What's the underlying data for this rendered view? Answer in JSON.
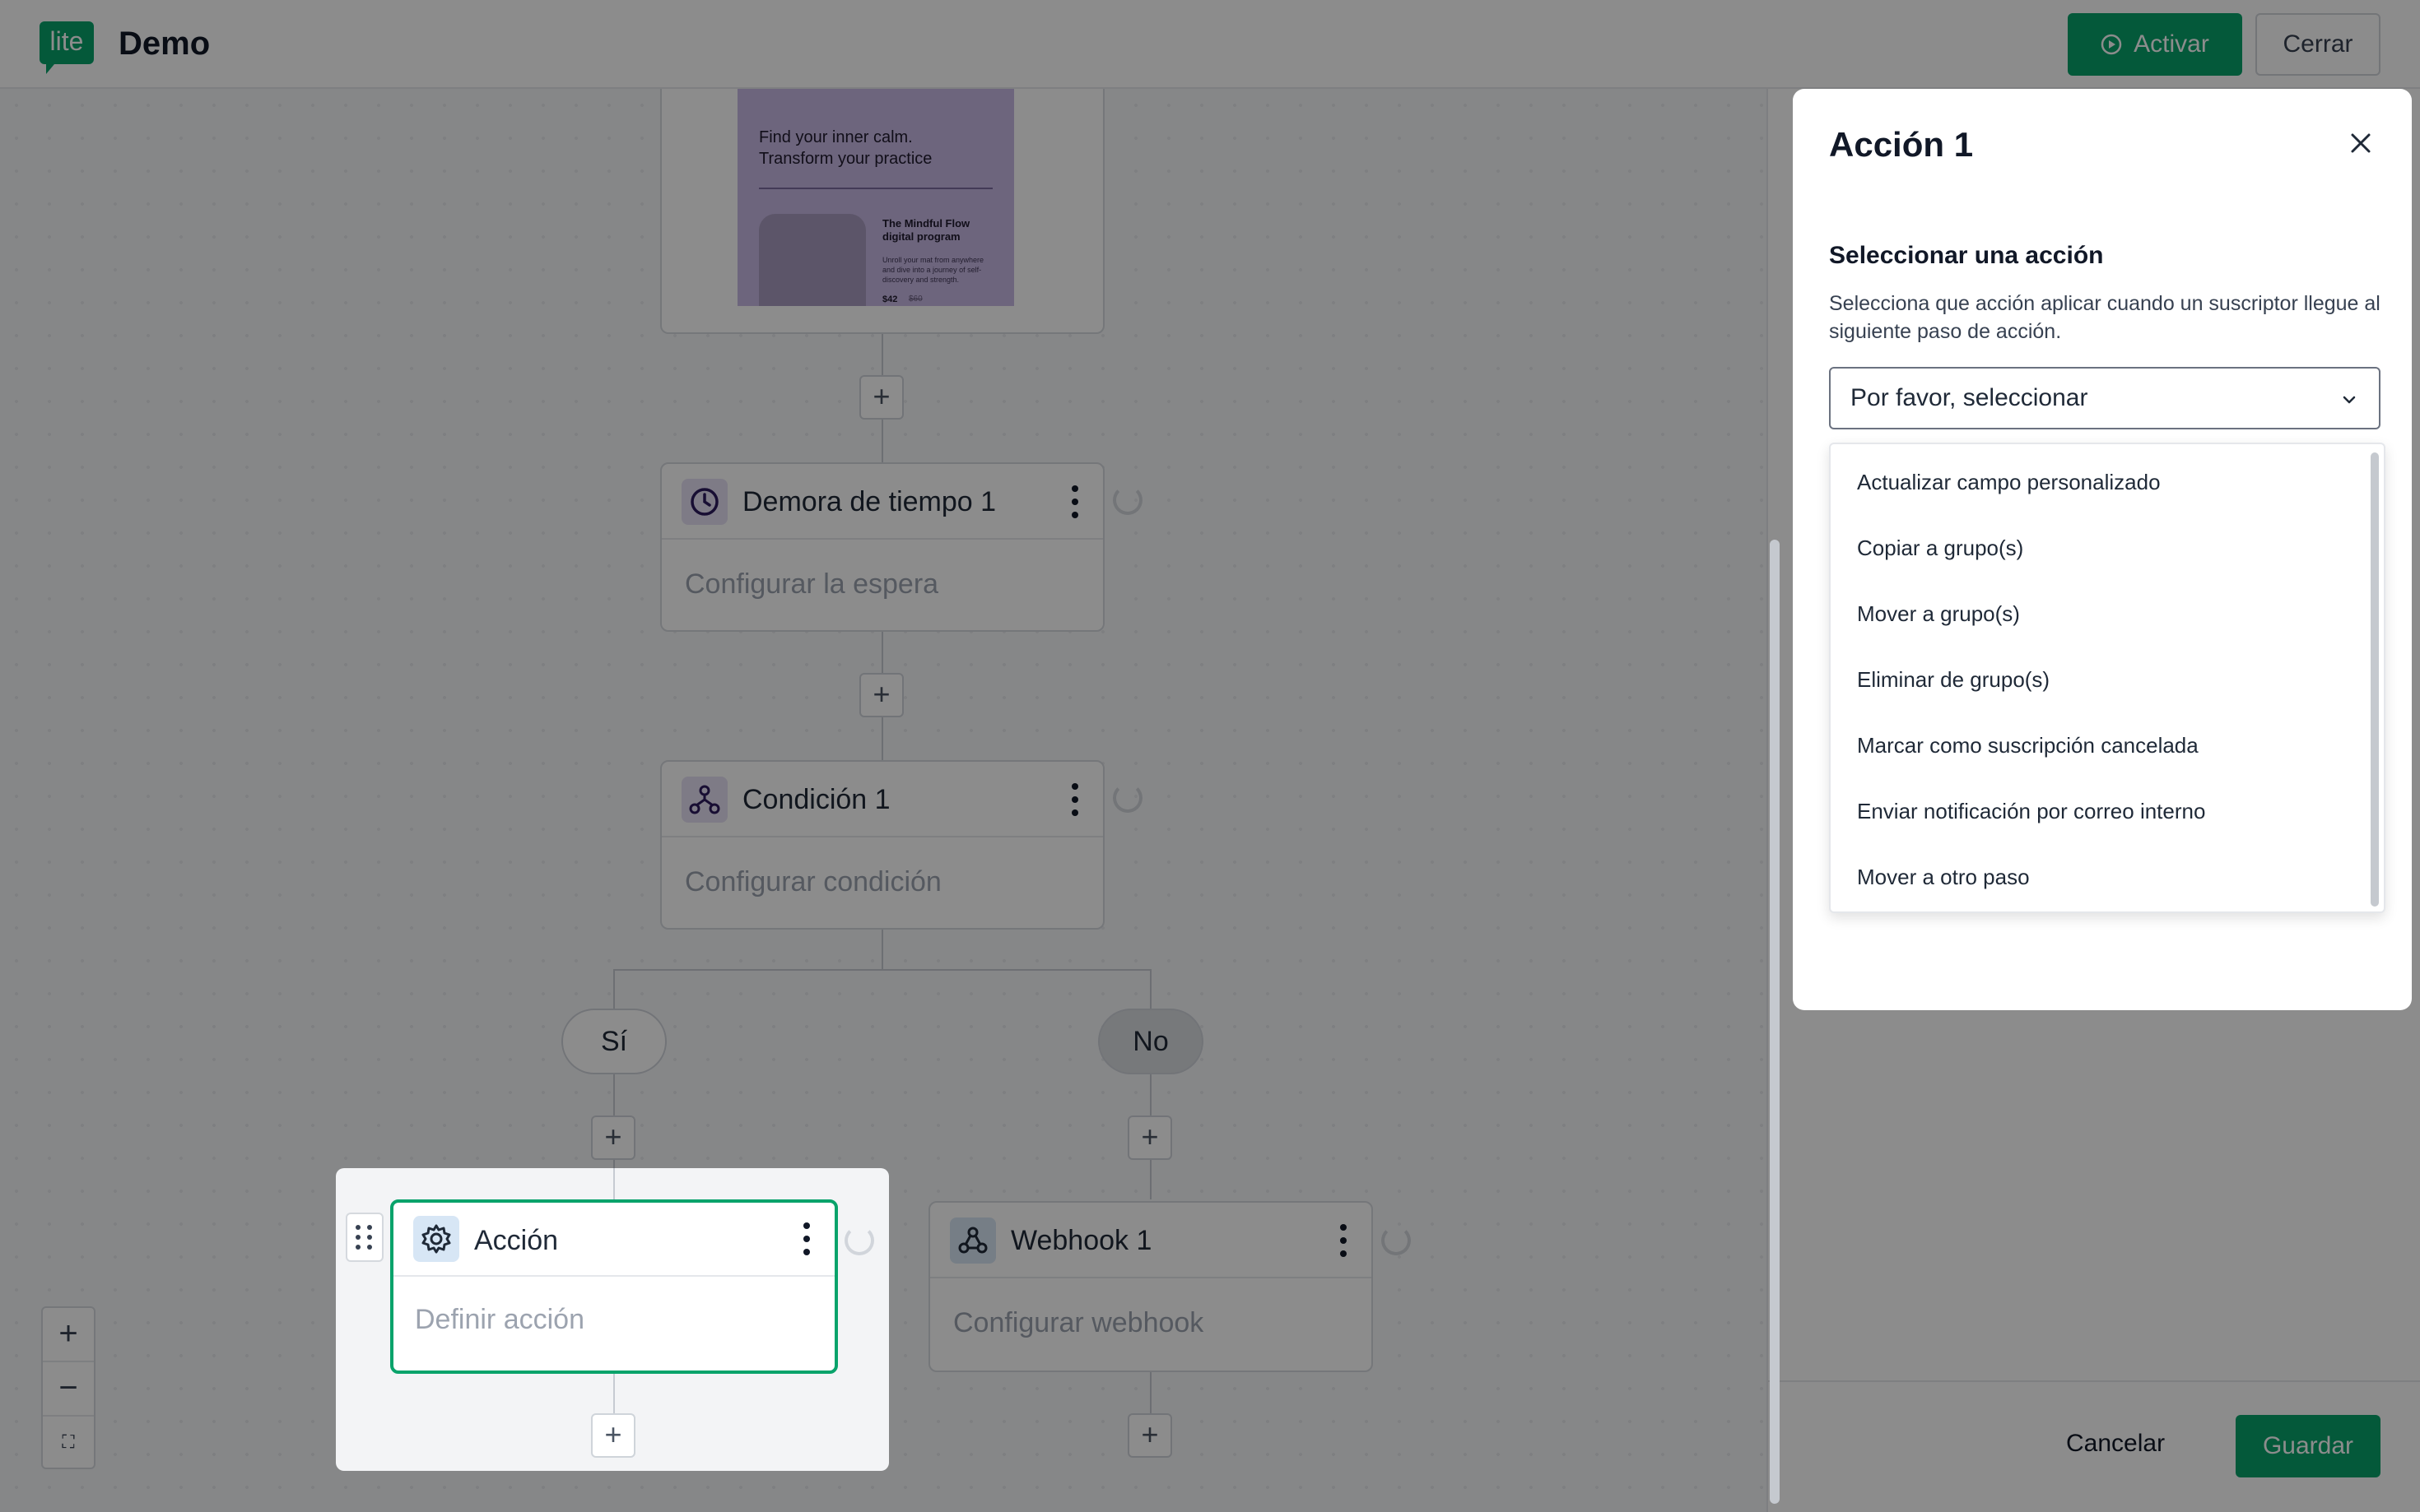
{
  "header": {
    "app_title": "Demo",
    "logo_text": "lite",
    "activate_label": "Activar",
    "close_label": "Cerrar",
    "brand_color": "#09a36b"
  },
  "canvas": {
    "email_preview": {
      "headline_line1": "Find your inner calm.",
      "headline_line2": "Transform your practice",
      "program_title": "The Mindful Flow digital program",
      "program_desc": "Unroll your mat from anywhere and dive into a journey of self-discovery and strength.",
      "price_new": "$42",
      "price_old": "$60"
    },
    "nodes": {
      "delay": {
        "title": "Demora de tiempo 1",
        "subtitle": "Configurar la espera"
      },
      "condition": {
        "title": "Condición 1",
        "subtitle": "Configurar condición"
      },
      "action": {
        "title": "Acción",
        "subtitle": "Definir acción"
      },
      "webhook": {
        "title": "Webhook 1",
        "subtitle": "Configurar webhook"
      }
    },
    "branches": {
      "yes": "Sí",
      "no": "No"
    },
    "zoom": {
      "in": "+",
      "out": "−",
      "fit": "⛶"
    }
  },
  "modal": {
    "title": "Acción 1",
    "section_label": "Seleccionar una acción",
    "section_desc": "Selecciona que acción aplicar cuando un suscriptor llegue al siguiente paso de acción.",
    "select_value": "Por favor, seleccionar",
    "options": [
      "Actualizar campo personalizado",
      "Copiar a grupo(s)",
      "Mover a grupo(s)",
      "Eliminar de grupo(s)",
      "Marcar como suscripción cancelada",
      "Enviar notificación por correo interno",
      "Mover a otro paso"
    ]
  },
  "sidebar": {
    "cancel_label": "Cancelar",
    "save_label": "Guardar"
  }
}
